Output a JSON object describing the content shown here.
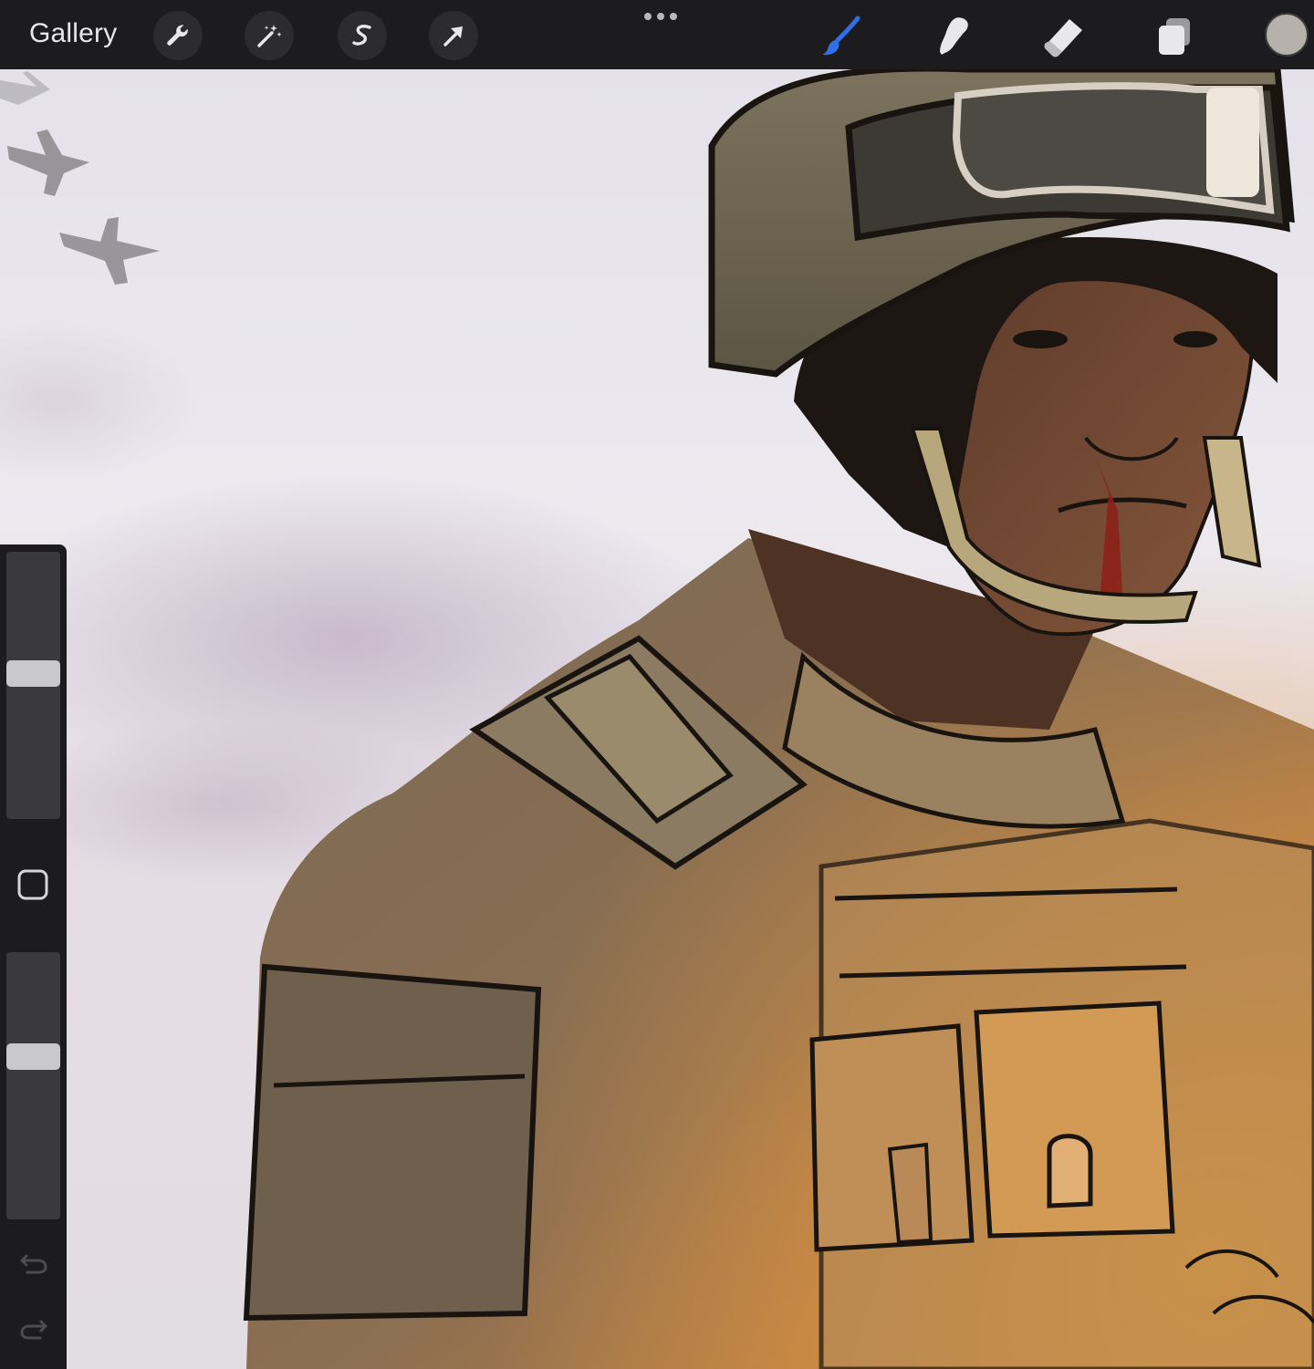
{
  "app": {
    "topbar": {
      "gallery_label": "Gallery",
      "left_tools": [
        "wrench-icon",
        "magic-wand-icon",
        "selection-icon",
        "transform-arrow-icon"
      ],
      "right_tools": [
        "brush-icon",
        "smudge-icon",
        "eraser-icon",
        "layers-icon"
      ],
      "active_tool": "brush",
      "accent_color": "#2f6fe8",
      "current_color": "#b6b1ab"
    },
    "sidebar": {
      "brush_size_level": 0.55,
      "opacity_level": 0.62,
      "modify_button": "square-icon",
      "undo": "undo-icon",
      "redo": "redo-icon"
    }
  },
  "colors": {
    "toolbar_bg": "#1c1c1e",
    "sky": "#e9e7ee",
    "sky_purple": "#c5b5c6",
    "warm_glow": "#f2a23a",
    "camo": "#7d6b53",
    "skin": "#6b4632",
    "outline": "#1a1410"
  }
}
